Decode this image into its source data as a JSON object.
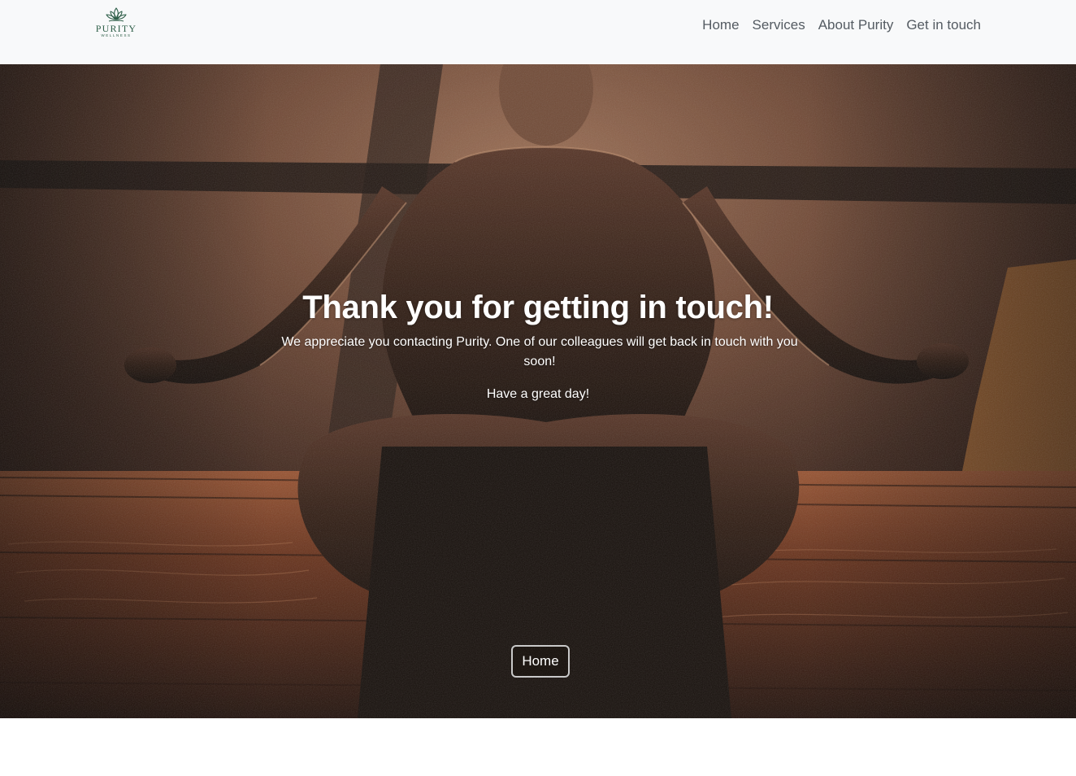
{
  "brand": {
    "name": "PURITY",
    "tagline": "WELLNESS",
    "color": "#2f5f49"
  },
  "nav": {
    "items": [
      {
        "label": "Home"
      },
      {
        "label": "Services"
      },
      {
        "label": "About Purity"
      },
      {
        "label": "Get in touch"
      }
    ]
  },
  "hero": {
    "title": "Thank you for getting in touch!",
    "message": "We appreciate you contacting Purity. One of our colleagues will get back in touch with you soon!",
    "closing": "Have a great day!",
    "button_label": "Home",
    "background": "photo of a person meditating in lotus pose, warm sunset light"
  },
  "colors": {
    "navbar_bg": "#f8f9fa",
    "nav_link": "#545b62",
    "hero_text": "#ffffff"
  }
}
